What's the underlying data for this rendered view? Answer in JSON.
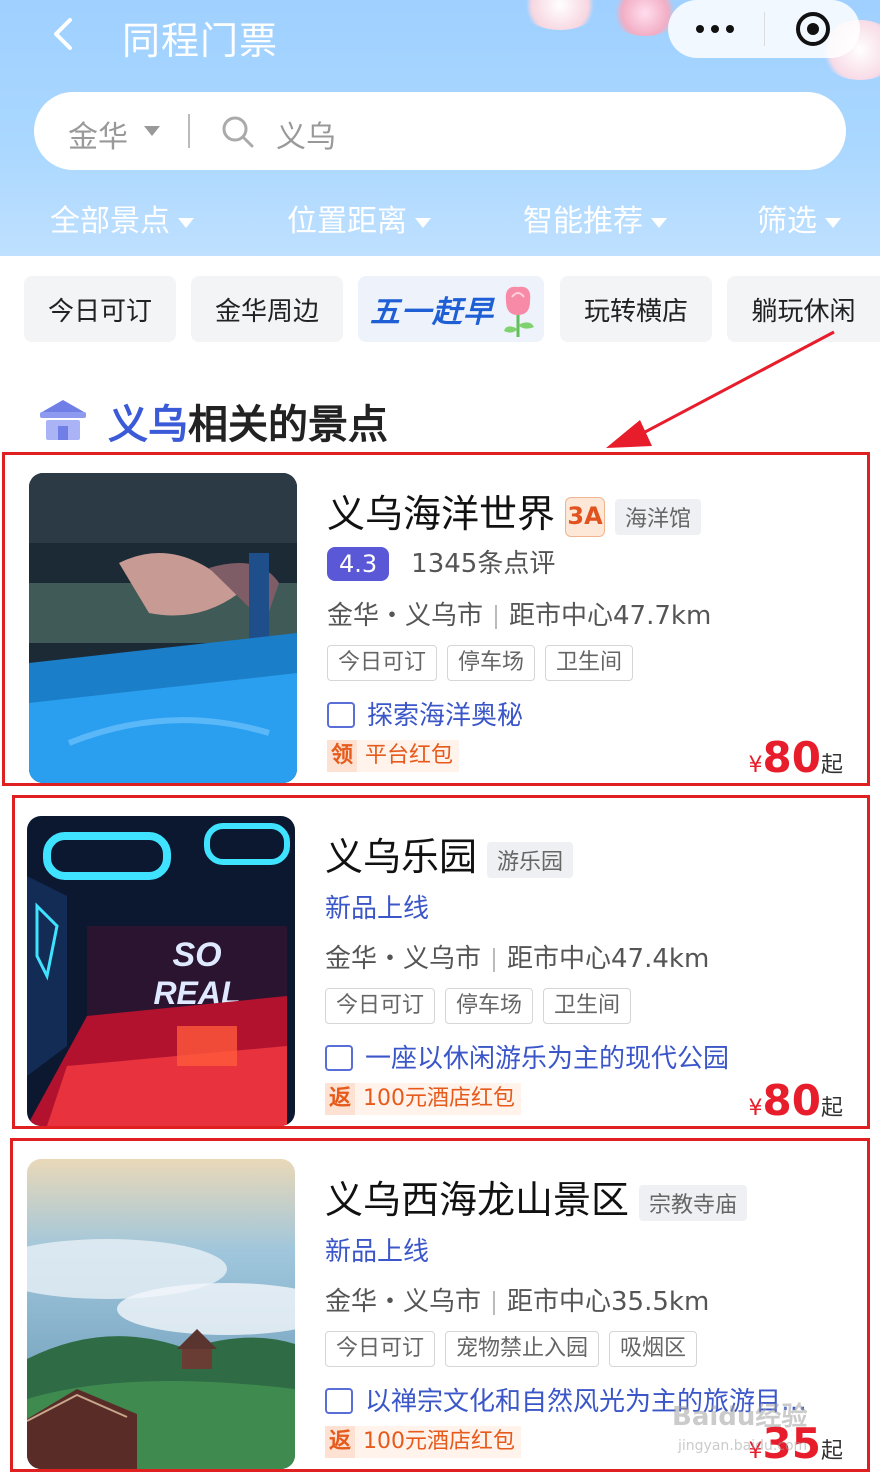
{
  "header": {
    "title": "同程门票",
    "search": {
      "city": "金华",
      "query": "义乌"
    },
    "filters": [
      "全部景点",
      "位置距离",
      "智能推荐",
      "筛选"
    ]
  },
  "chips": [
    "今日可订",
    "金华周边",
    "五一赶早",
    "玩转横店",
    "躺玩休闲"
  ],
  "section": {
    "highlight": "义乌",
    "title_rest": "相关的景点"
  },
  "cards": [
    {
      "name": "义乌海洋世界",
      "grade": "3A",
      "category": "海洋馆",
      "score": "4.3",
      "reviews": "1345条点评",
      "location": "金华・义乌市",
      "distance": "距市中心47.7km",
      "tags": [
        "今日可订",
        "停车场",
        "卫生间"
      ],
      "desc": "探索海洋奥秘",
      "promo_badge": "领",
      "promo": "平台红包",
      "price_symbol": "¥",
      "price": "80",
      "price_suffix": "起"
    },
    {
      "name": "义乌乐园",
      "category": "游乐园",
      "newtag": "新品上线",
      "location": "金华・义乌市",
      "distance": "距市中心47.4km",
      "tags": [
        "今日可订",
        "停车场",
        "卫生间"
      ],
      "desc": "一座以休闲游乐为主的现代公园",
      "promo_badge": "返",
      "promo": "100元酒店红包",
      "price_symbol": "¥",
      "price": "80",
      "price_suffix": "起"
    },
    {
      "name": "义乌西海龙山景区",
      "category": "宗教寺庙",
      "newtag": "新品上线",
      "location": "金华・义乌市",
      "distance": "距市中心35.5km",
      "tags": [
        "今日可订",
        "宠物禁止入园",
        "吸烟区"
      ],
      "desc": "以禅宗文化和自然风光为主的旅游目…",
      "promo_badge": "返",
      "promo": "100元酒店红包",
      "price_symbol": "¥",
      "price": "35",
      "price_suffix": "起"
    }
  ],
  "watermark": {
    "main": "Baidu经验",
    "sub": "jingyan.baidu.com"
  },
  "colors": {
    "accent": "#3a5ad8",
    "price": "#e81d2b",
    "highlight_box": "#e02020",
    "header_bg": "#a9d7ff"
  }
}
